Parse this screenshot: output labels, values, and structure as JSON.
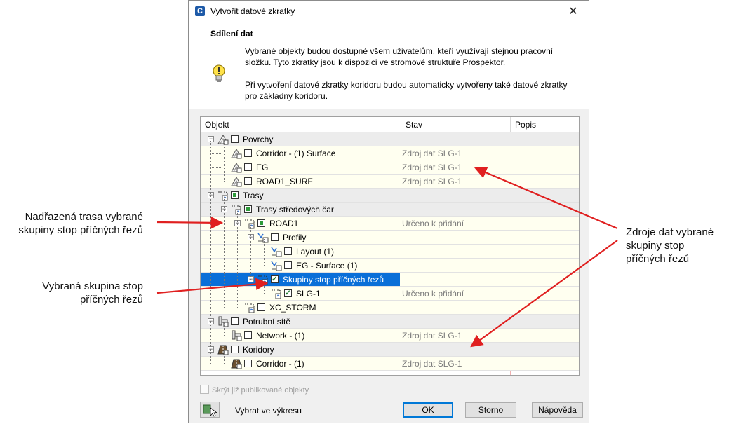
{
  "dialog": {
    "title": "Vytvořit datové zkratky",
    "close_glyph": "✕",
    "app_icon_letter": "C",
    "heading": "Sdílení dat",
    "description1": "Vybrané objekty budou dostupné všem uživatelům, kteří využívají stejnou pracovní složku. Tyto zkratky jsou k dispozici ve stromové struktuře Prospektor.",
    "description2": "Při vytvoření datové zkratky koridoru budou automaticky vytvořeny také datové zkratky pro základny koridoru.",
    "grid": {
      "columns": [
        "Objekt",
        "Stav",
        "Popis"
      ],
      "rows": [
        {
          "label": "Povrchy",
          "state": ""
        },
        {
          "label": "Corridor - (1) Surface",
          "state": "Zdroj dat SLG-1"
        },
        {
          "label": "EG",
          "state": "Zdroj dat SLG-1"
        },
        {
          "label": "ROAD1_SURF",
          "state": "Zdroj dat SLG-1"
        },
        {
          "label": "Trasy",
          "state": ""
        },
        {
          "label": "Trasy středových čar",
          "state": ""
        },
        {
          "label": "ROAD1",
          "state": "Určeno k přidání"
        },
        {
          "label": "Profily",
          "state": ""
        },
        {
          "label": "Layout (1)",
          "state": ""
        },
        {
          "label": "EG - Surface (1)",
          "state": ""
        },
        {
          "label": "Skupiny stop příčných řezů",
          "state": ""
        },
        {
          "label": "SLG-1",
          "state": "Určeno k přidání"
        },
        {
          "label": "XC_STORM",
          "state": ""
        },
        {
          "label": "Potrubní sítě",
          "state": ""
        },
        {
          "label": "Network - (1)",
          "state": "Zdroj dat SLG-1"
        },
        {
          "label": "Koridory",
          "state": ""
        },
        {
          "label": "Corridor - (1)",
          "state": "Zdroj dat SLG-1"
        }
      ]
    },
    "hide_published_label": "Skrýt již publikované objekty",
    "pick_in_drawing_label": "Vybrat ve výkresu",
    "buttons": {
      "ok": "OK",
      "cancel": "Storno",
      "help": "Nápověda"
    }
  },
  "callouts": {
    "parent_alignment": [
      "Nadřazená trasa vybrané",
      "skupiny stop příčných řezů"
    ],
    "selected_group": [
      "Vybraná skupina stop",
      "příčných řezů"
    ],
    "data_sources": [
      "Zdroje dat vybrané",
      "skupiny stop",
      "příčných řezů"
    ]
  },
  "colors": {
    "selection": "#0a6fd8",
    "category_row": "#ececec",
    "item_row": "#fffff0",
    "arrow": "#e02020",
    "check_green": "#2d9b3a"
  }
}
